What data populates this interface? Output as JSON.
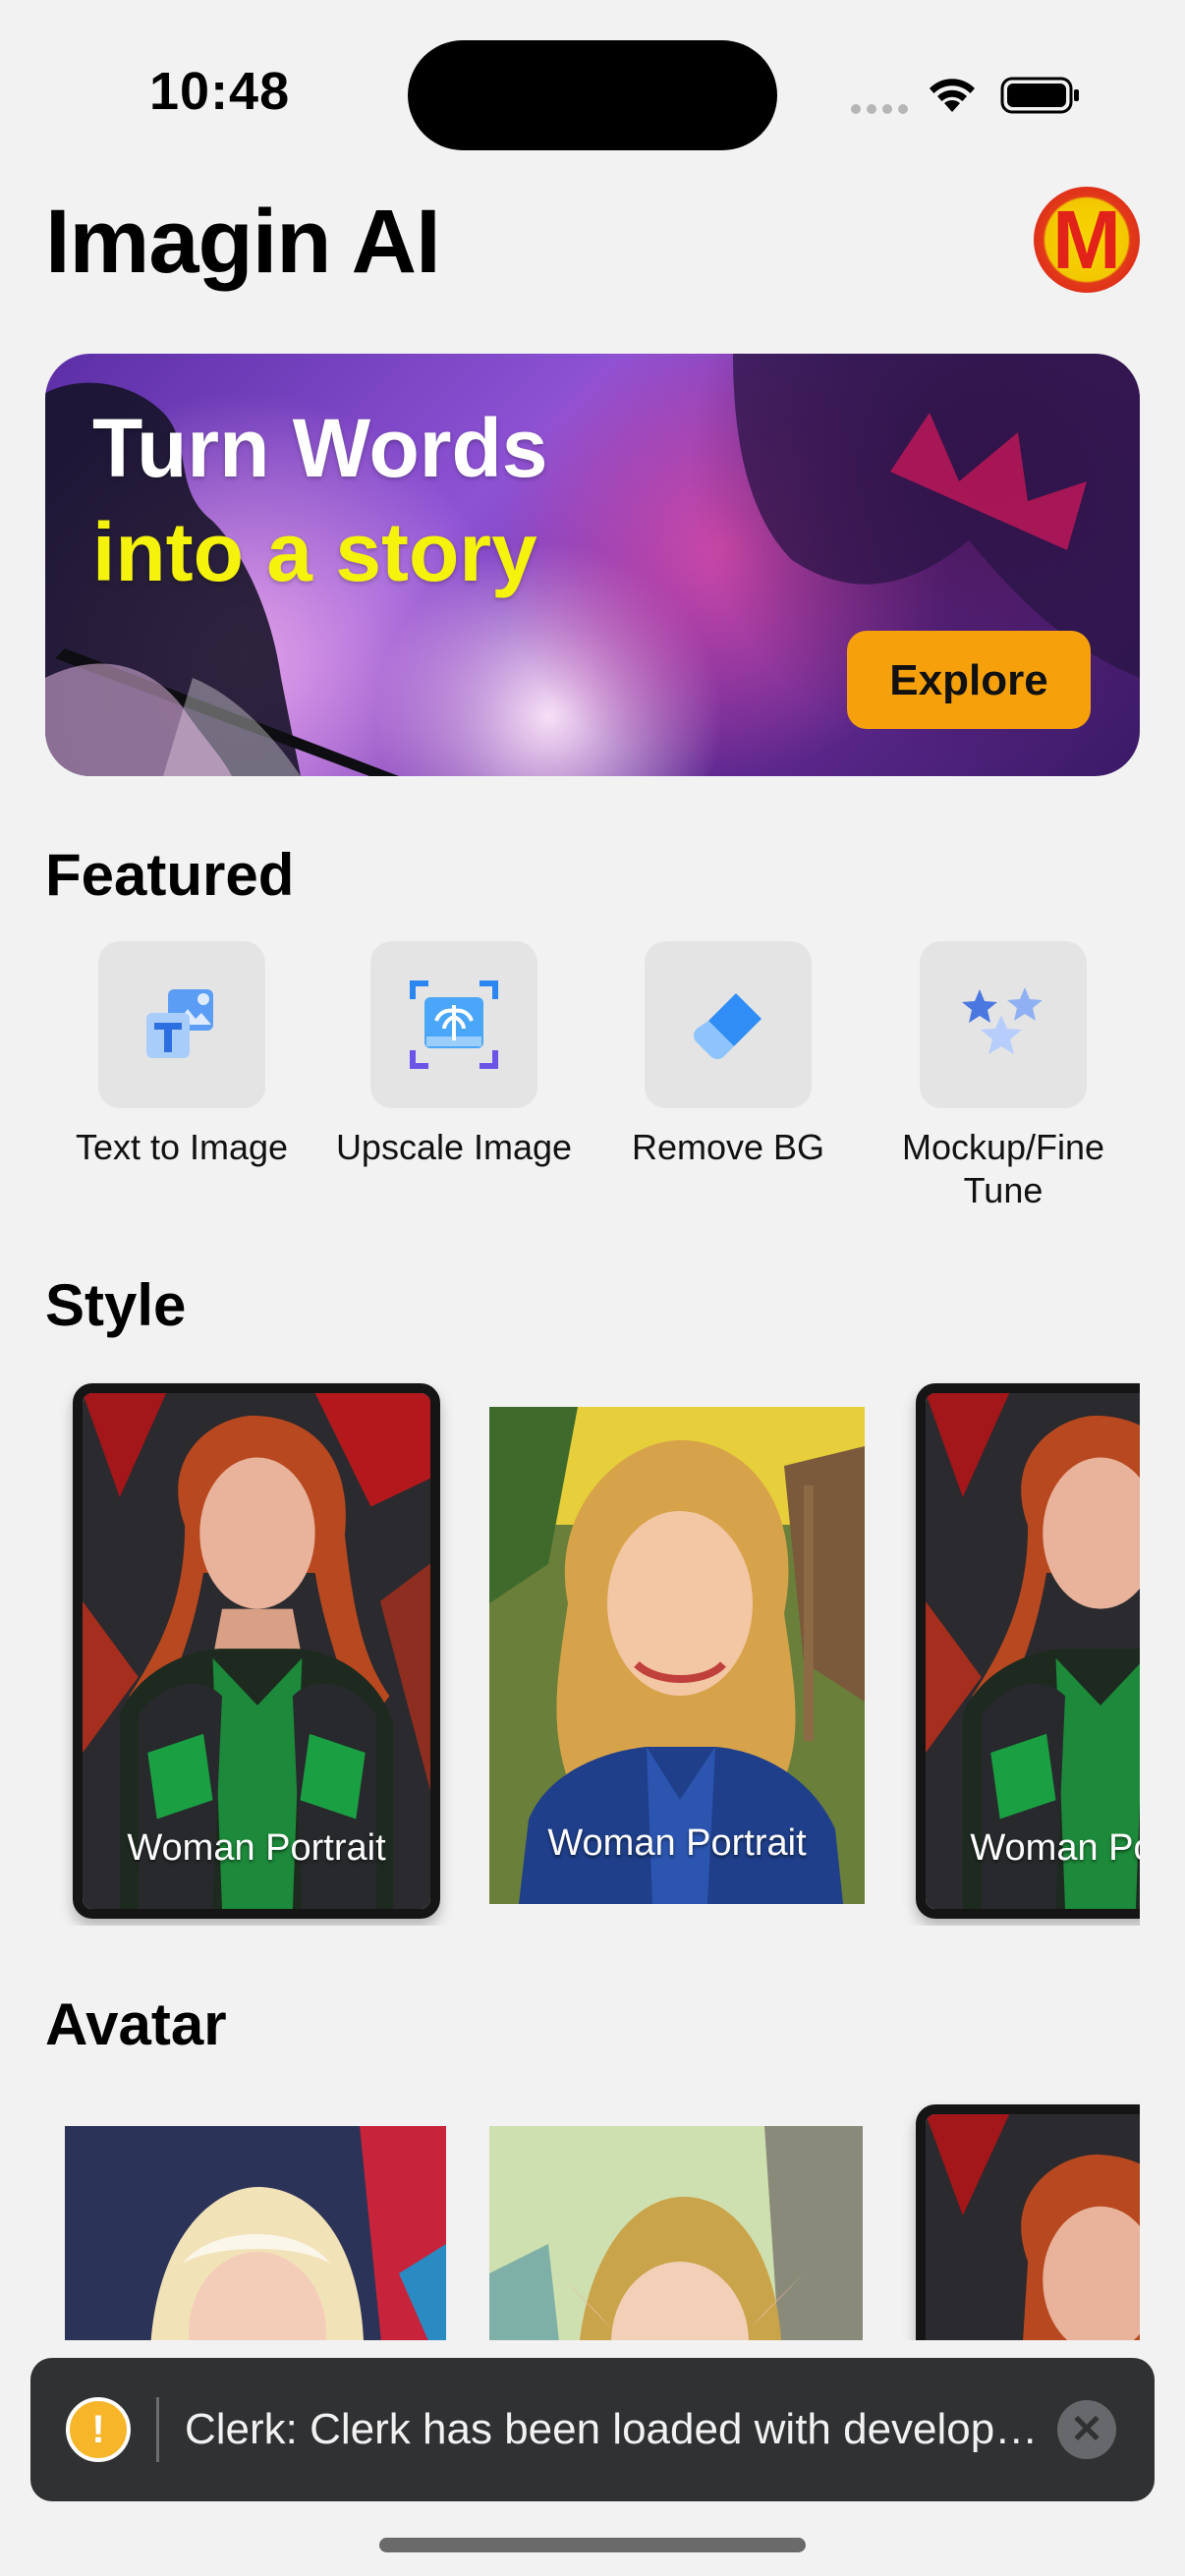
{
  "status_bar": {
    "time": "10:48"
  },
  "header": {
    "title": "Imagin AI",
    "avatar_letter": "M"
  },
  "banner": {
    "line1": "Turn Words",
    "line2": "into a story",
    "button_label": "Explore",
    "line2_color": "#f5f20b",
    "button_color": "#f6a10b"
  },
  "featured": {
    "heading": "Featured",
    "items": [
      {
        "label": "Text to Image",
        "icon": "text-to-image-icon"
      },
      {
        "label": "Upscale Image",
        "icon": "upscale-image-icon"
      },
      {
        "label": "Remove BG",
        "icon": "eraser-icon"
      },
      {
        "label": "Mockup/Fine Tune",
        "icon": "sparkle-stars-icon"
      }
    ]
  },
  "style": {
    "heading": "Style",
    "cards": [
      {
        "label": "Woman Portrait"
      },
      {
        "label": "Woman Portrait"
      },
      {
        "label": "Woman Portrait"
      }
    ]
  },
  "avatar_section": {
    "heading": "Avatar"
  },
  "toast": {
    "message": "Clerk: Clerk has been loaded with development keys",
    "icon": "warning-icon",
    "close_icon": "close-icon"
  }
}
